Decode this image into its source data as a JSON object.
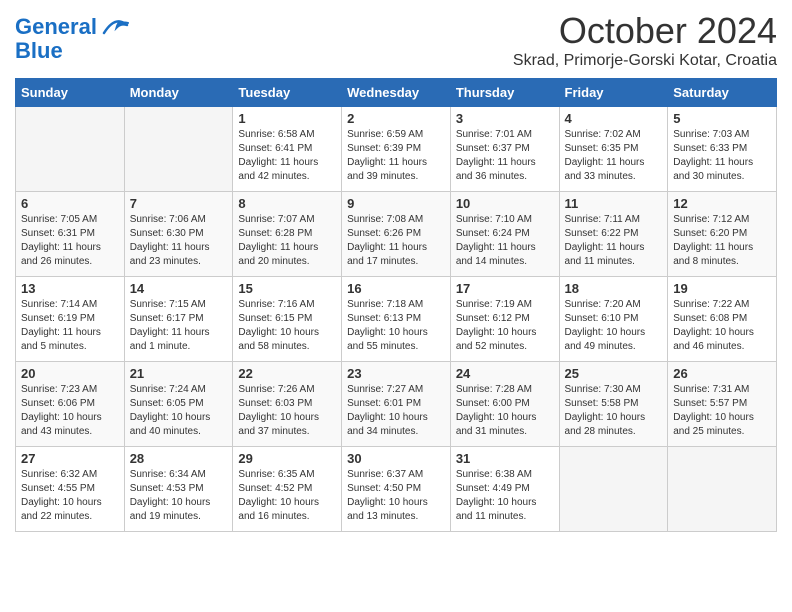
{
  "header": {
    "logo_line1": "General",
    "logo_line2": "Blue",
    "month": "October 2024",
    "location": "Skrad, Primorje-Gorski Kotar, Croatia"
  },
  "weekdays": [
    "Sunday",
    "Monday",
    "Tuesday",
    "Wednesday",
    "Thursday",
    "Friday",
    "Saturday"
  ],
  "weeks": [
    [
      {
        "day": "",
        "sunrise": "",
        "sunset": "",
        "daylight": ""
      },
      {
        "day": "",
        "sunrise": "",
        "sunset": "",
        "daylight": ""
      },
      {
        "day": "1",
        "sunrise": "Sunrise: 6:58 AM",
        "sunset": "Sunset: 6:41 PM",
        "daylight": "Daylight: 11 hours and 42 minutes."
      },
      {
        "day": "2",
        "sunrise": "Sunrise: 6:59 AM",
        "sunset": "Sunset: 6:39 PM",
        "daylight": "Daylight: 11 hours and 39 minutes."
      },
      {
        "day": "3",
        "sunrise": "Sunrise: 7:01 AM",
        "sunset": "Sunset: 6:37 PM",
        "daylight": "Daylight: 11 hours and 36 minutes."
      },
      {
        "day": "4",
        "sunrise": "Sunrise: 7:02 AM",
        "sunset": "Sunset: 6:35 PM",
        "daylight": "Daylight: 11 hours and 33 minutes."
      },
      {
        "day": "5",
        "sunrise": "Sunrise: 7:03 AM",
        "sunset": "Sunset: 6:33 PM",
        "daylight": "Daylight: 11 hours and 30 minutes."
      }
    ],
    [
      {
        "day": "6",
        "sunrise": "Sunrise: 7:05 AM",
        "sunset": "Sunset: 6:31 PM",
        "daylight": "Daylight: 11 hours and 26 minutes."
      },
      {
        "day": "7",
        "sunrise": "Sunrise: 7:06 AM",
        "sunset": "Sunset: 6:30 PM",
        "daylight": "Daylight: 11 hours and 23 minutes."
      },
      {
        "day": "8",
        "sunrise": "Sunrise: 7:07 AM",
        "sunset": "Sunset: 6:28 PM",
        "daylight": "Daylight: 11 hours and 20 minutes."
      },
      {
        "day": "9",
        "sunrise": "Sunrise: 7:08 AM",
        "sunset": "Sunset: 6:26 PM",
        "daylight": "Daylight: 11 hours and 17 minutes."
      },
      {
        "day": "10",
        "sunrise": "Sunrise: 7:10 AM",
        "sunset": "Sunset: 6:24 PM",
        "daylight": "Daylight: 11 hours and 14 minutes."
      },
      {
        "day": "11",
        "sunrise": "Sunrise: 7:11 AM",
        "sunset": "Sunset: 6:22 PM",
        "daylight": "Daylight: 11 hours and 11 minutes."
      },
      {
        "day": "12",
        "sunrise": "Sunrise: 7:12 AM",
        "sunset": "Sunset: 6:20 PM",
        "daylight": "Daylight: 11 hours and 8 minutes."
      }
    ],
    [
      {
        "day": "13",
        "sunrise": "Sunrise: 7:14 AM",
        "sunset": "Sunset: 6:19 PM",
        "daylight": "Daylight: 11 hours and 5 minutes."
      },
      {
        "day": "14",
        "sunrise": "Sunrise: 7:15 AM",
        "sunset": "Sunset: 6:17 PM",
        "daylight": "Daylight: 11 hours and 1 minute."
      },
      {
        "day": "15",
        "sunrise": "Sunrise: 7:16 AM",
        "sunset": "Sunset: 6:15 PM",
        "daylight": "Daylight: 10 hours and 58 minutes."
      },
      {
        "day": "16",
        "sunrise": "Sunrise: 7:18 AM",
        "sunset": "Sunset: 6:13 PM",
        "daylight": "Daylight: 10 hours and 55 minutes."
      },
      {
        "day": "17",
        "sunrise": "Sunrise: 7:19 AM",
        "sunset": "Sunset: 6:12 PM",
        "daylight": "Daylight: 10 hours and 52 minutes."
      },
      {
        "day": "18",
        "sunrise": "Sunrise: 7:20 AM",
        "sunset": "Sunset: 6:10 PM",
        "daylight": "Daylight: 10 hours and 49 minutes."
      },
      {
        "day": "19",
        "sunrise": "Sunrise: 7:22 AM",
        "sunset": "Sunset: 6:08 PM",
        "daylight": "Daylight: 10 hours and 46 minutes."
      }
    ],
    [
      {
        "day": "20",
        "sunrise": "Sunrise: 7:23 AM",
        "sunset": "Sunset: 6:06 PM",
        "daylight": "Daylight: 10 hours and 43 minutes."
      },
      {
        "day": "21",
        "sunrise": "Sunrise: 7:24 AM",
        "sunset": "Sunset: 6:05 PM",
        "daylight": "Daylight: 10 hours and 40 minutes."
      },
      {
        "day": "22",
        "sunrise": "Sunrise: 7:26 AM",
        "sunset": "Sunset: 6:03 PM",
        "daylight": "Daylight: 10 hours and 37 minutes."
      },
      {
        "day": "23",
        "sunrise": "Sunrise: 7:27 AM",
        "sunset": "Sunset: 6:01 PM",
        "daylight": "Daylight: 10 hours and 34 minutes."
      },
      {
        "day": "24",
        "sunrise": "Sunrise: 7:28 AM",
        "sunset": "Sunset: 6:00 PM",
        "daylight": "Daylight: 10 hours and 31 minutes."
      },
      {
        "day": "25",
        "sunrise": "Sunrise: 7:30 AM",
        "sunset": "Sunset: 5:58 PM",
        "daylight": "Daylight: 10 hours and 28 minutes."
      },
      {
        "day": "26",
        "sunrise": "Sunrise: 7:31 AM",
        "sunset": "Sunset: 5:57 PM",
        "daylight": "Daylight: 10 hours and 25 minutes."
      }
    ],
    [
      {
        "day": "27",
        "sunrise": "Sunrise: 6:32 AM",
        "sunset": "Sunset: 4:55 PM",
        "daylight": "Daylight: 10 hours and 22 minutes."
      },
      {
        "day": "28",
        "sunrise": "Sunrise: 6:34 AM",
        "sunset": "Sunset: 4:53 PM",
        "daylight": "Daylight: 10 hours and 19 minutes."
      },
      {
        "day": "29",
        "sunrise": "Sunrise: 6:35 AM",
        "sunset": "Sunset: 4:52 PM",
        "daylight": "Daylight: 10 hours and 16 minutes."
      },
      {
        "day": "30",
        "sunrise": "Sunrise: 6:37 AM",
        "sunset": "Sunset: 4:50 PM",
        "daylight": "Daylight: 10 hours and 13 minutes."
      },
      {
        "day": "31",
        "sunrise": "Sunrise: 6:38 AM",
        "sunset": "Sunset: 4:49 PM",
        "daylight": "Daylight: 10 hours and 11 minutes."
      },
      {
        "day": "",
        "sunrise": "",
        "sunset": "",
        "daylight": ""
      },
      {
        "day": "",
        "sunrise": "",
        "sunset": "",
        "daylight": ""
      }
    ]
  ]
}
